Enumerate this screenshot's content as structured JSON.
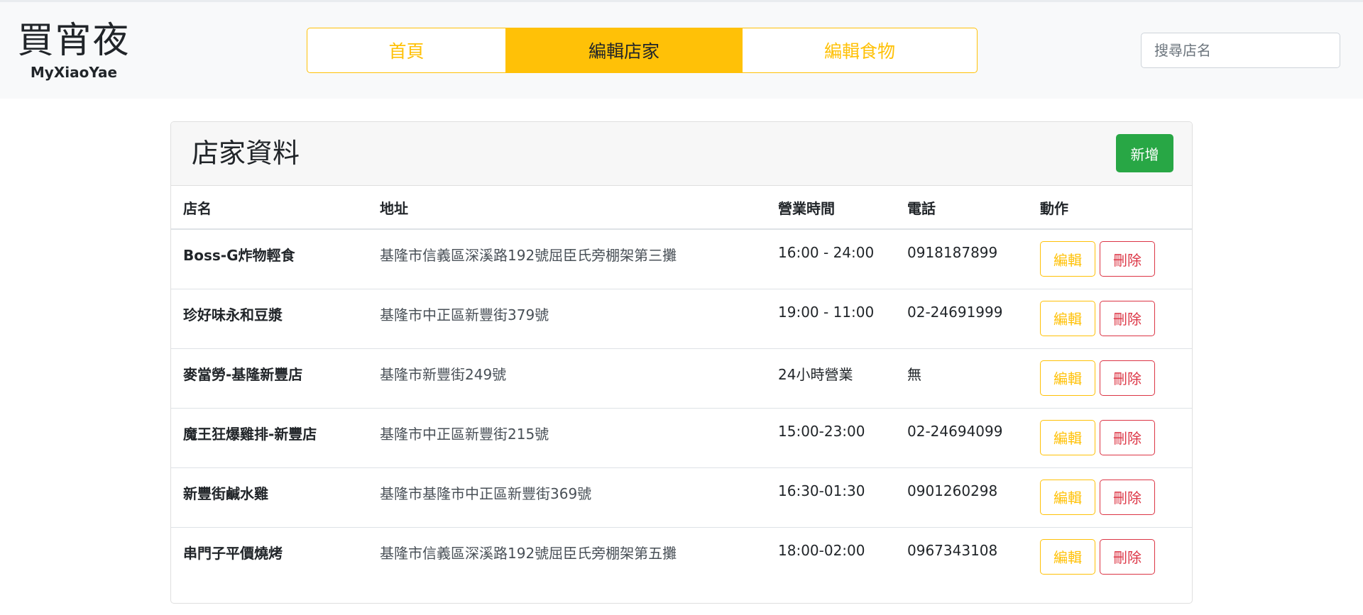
{
  "brand": {
    "title": "買宵夜",
    "subtitle": "MyXiaoYae"
  },
  "nav": {
    "tabs": [
      {
        "label": "首頁",
        "active": false
      },
      {
        "label": "編輯店家",
        "active": true
      },
      {
        "label": "編輯食物",
        "active": false
      }
    ]
  },
  "search": {
    "placeholder": "搜尋店名",
    "value": ""
  },
  "card": {
    "title": "店家資料",
    "add_label": "新增",
    "columns": [
      "店名",
      "地址",
      "營業時間",
      "電話",
      "動作"
    ],
    "rows": [
      {
        "name": "Boss-G炸物輕食",
        "address": "基隆市信義區深溪路192號屈臣氏旁棚架第三攤",
        "hours": "16:00 - 24:00",
        "phone": "0918187899"
      },
      {
        "name": "珍好味永和豆漿",
        "address": "基隆市中正區新豐街379號",
        "hours": "19:00 - 11:00",
        "phone": "02-24691999"
      },
      {
        "name": "麥當勞-基隆新豐店",
        "address": "基隆市新豐街249號",
        "hours": "24小時營業",
        "phone": "無"
      },
      {
        "name": "魔王狂爆雞排-新豐店",
        "address": "基隆市中正區新豐街215號",
        "hours": "15:00-23:00",
        "phone": "02-24694099"
      },
      {
        "name": "新豐街鹹水雞",
        "address": "基隆市基隆市中正區新豐街369號",
        "hours": "16:30-01:30",
        "phone": "0901260298"
      },
      {
        "name": "串門子平價燒烤",
        "address": "基隆市信義區深溪路192號屈臣氏旁棚架第五攤",
        "hours": "18:00-02:00",
        "phone": "0967343108"
      }
    ],
    "edit_label": "編輯",
    "delete_label": "刪除"
  },
  "colors": {
    "warning": "#ffc107",
    "success": "#28a745",
    "danger": "#dc3545",
    "navbar_bg": "#f8f9fa"
  }
}
